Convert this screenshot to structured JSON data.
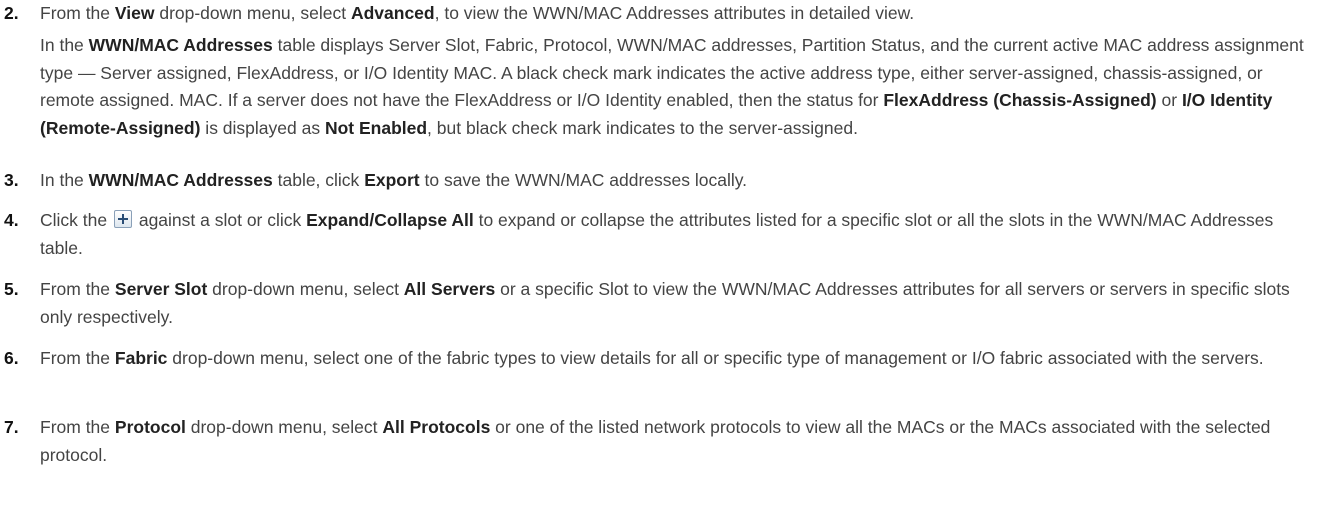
{
  "steps": [
    {
      "num": "2.",
      "p1": {
        "a": "From the ",
        "b1": "View",
        "c": " drop-down menu, select ",
        "b2": "Advanced",
        "d": ", to view the WWN/MAC Addresses attributes in detailed view."
      },
      "p2": {
        "a": "In the ",
        "b1": "WWN/MAC Addresses",
        "c": " table displays Server Slot, Fabric, Protocol, WWN/MAC addresses, Partition Status, and the current active MAC address assignment type — Server assigned, FlexAddress, or I/O Identity MAC. A black check mark indicates the active address type, either server-assigned, chassis-assigned, or remote assigned. MAC. If a server does not have the FlexAddress or I/O Identity enabled, then the status for ",
        "b2": "FlexAddress (Chassis-Assigned)",
        "d": " or ",
        "b3": "I/O Identity (Remote-Assigned)",
        "e": " is displayed as ",
        "b4": "Not Enabled",
        "f": ", but black check mark indicates to the server-assigned."
      }
    },
    {
      "num": "3.",
      "a": "In the ",
      "b1": "WWN/MAC Addresses",
      "c": " table, click ",
      "b2": "Export",
      "d": " to save the WWN/MAC addresses locally."
    },
    {
      "num": "4.",
      "a": "Click the ",
      "icon": "plus-expand-icon",
      "c": " against a slot or click ",
      "b1": "Expand/Collapse All",
      "d": " to expand or collapse the attributes listed for a specific slot or all the slots in the WWN/MAC Addresses table."
    },
    {
      "num": "5.",
      "a": "From the ",
      "b1": "Server Slot",
      "c": " drop-down menu, select ",
      "b2": "All Servers",
      "d": " or a specific Slot to view the WWN/MAC Addresses attributes for all servers or servers in specific slots only respectively."
    },
    {
      "num": "6.",
      "a": "From the ",
      "b1": "Fabric",
      "c": " drop-down menu, select one of the fabric types to view details for all or specific type of management or I/O fabric associated with the servers."
    },
    {
      "num": "7.",
      "a": "From the ",
      "b1": "Protocol",
      "c": " drop-down menu, select ",
      "b2": "All Protocols",
      "d": " or one of the listed network protocols to view all the MACs or the MACs associated with the selected protocol."
    }
  ]
}
